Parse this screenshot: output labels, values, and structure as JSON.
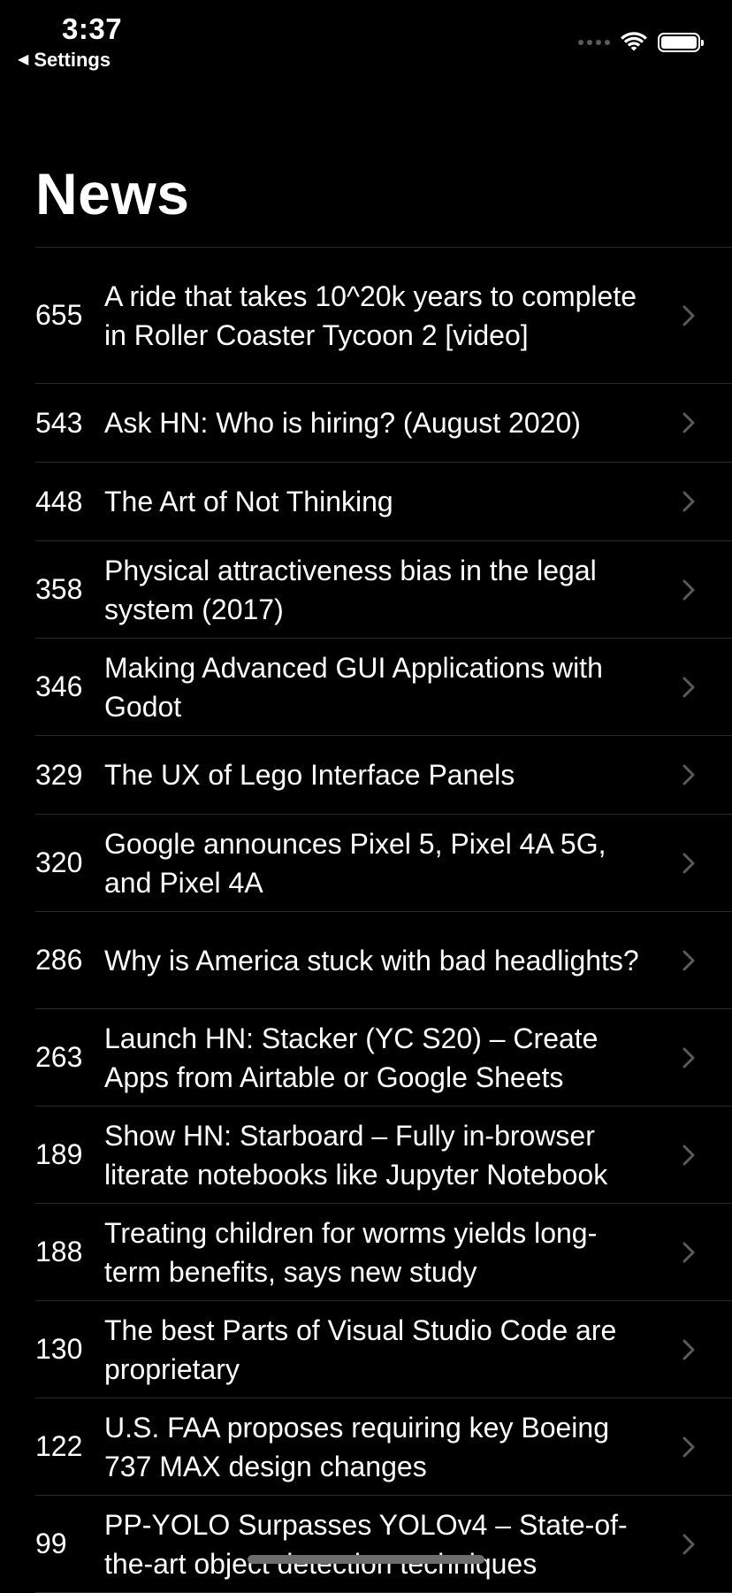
{
  "status_bar": {
    "time": "3:37",
    "back_label": "Settings",
    "signal_icon": "signal-dots-icon",
    "wifi_icon": "wifi-icon",
    "battery_icon": "battery-icon"
  },
  "page": {
    "title": "News"
  },
  "items": [
    {
      "score": "655",
      "title": "A ride that takes 10^20k years to complete in Roller Coaster Tycoon 2 [video]"
    },
    {
      "score": "543",
      "title": "Ask HN: Who is hiring? (August 2020)"
    },
    {
      "score": "448",
      "title": "The Art of Not Thinking"
    },
    {
      "score": "358",
      "title": "Physical attractiveness bias in the legal system (2017)"
    },
    {
      "score": "346",
      "title": "Making Advanced GUI Applications with Godot"
    },
    {
      "score": "329",
      "title": "The UX of Lego Interface Panels"
    },
    {
      "score": "320",
      "title": "Google announces Pixel 5, Pixel 4A 5G, and Pixel 4A"
    },
    {
      "score": "286",
      "title": "Why is America stuck with bad headlights?"
    },
    {
      "score": "263",
      "title": "Launch HN: Stacker (YC S20) – Create Apps from Airtable or Google Sheets"
    },
    {
      "score": "189",
      "title": "Show HN: Starboard – Fully in-browser literate notebooks like Jupyter Notebook"
    },
    {
      "score": "188",
      "title": "Treating children for worms yields long-term benefits, says new study"
    },
    {
      "score": "130",
      "title": "The best Parts of Visual Studio Code are proprietary"
    },
    {
      "score": "122",
      "title": "U.S. FAA proposes requiring key Boeing 737 MAX design changes"
    },
    {
      "score": "99",
      "title": "PP-YOLO Surpasses YOLOv4 – State-of-the-art object detection techniques"
    }
  ]
}
